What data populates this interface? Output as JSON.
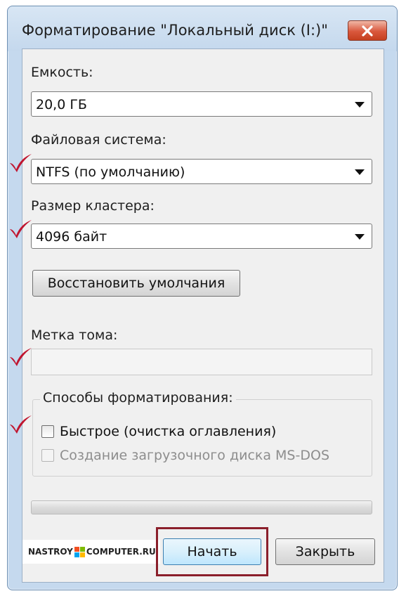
{
  "window": {
    "title": "Форматирование \"Локальный диск (I:)\""
  },
  "capacity": {
    "label": "Емкость:",
    "value": "20,0 ГБ"
  },
  "file_system": {
    "label": "Файловая система:",
    "value": "NTFS (по умолчанию)"
  },
  "cluster_size": {
    "label": "Размер кластера:",
    "value": "4096 байт"
  },
  "restore_defaults": {
    "label": "Восстановить умолчания"
  },
  "volume_label": {
    "label": "Метка тома:",
    "value": ""
  },
  "format_options": {
    "legend": "Способы форматирования:",
    "quick": {
      "label": "Быстрое (очистка оглавления)",
      "checked": false
    },
    "msdos": {
      "label": "Создание загрузочного диска MS-DOS",
      "checked": false,
      "enabled": false
    }
  },
  "progress": {
    "fraction": 0
  },
  "watermark": {
    "left": "NASTROY",
    "right": "COMPUTER.RU"
  },
  "buttons": {
    "start": "Начать",
    "close": "Закрыть"
  },
  "colors": {
    "check_mark": "#c0152f",
    "highlight_border": "#8b1f2b"
  }
}
